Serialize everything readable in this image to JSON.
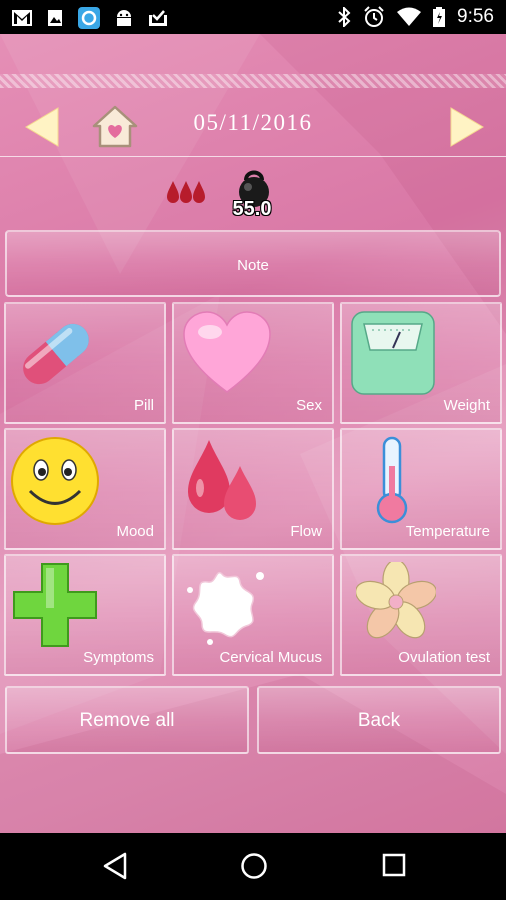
{
  "status_bar": {
    "time": "9:56",
    "left_icons": [
      "gmail-icon",
      "photo-icon",
      "sync-app-icon",
      "android-icon",
      "download-done-icon"
    ],
    "right_icons": [
      "bluetooth-icon",
      "alarm-icon",
      "wifi-icon",
      "battery-icon"
    ]
  },
  "header": {
    "date": "05/11/2016",
    "prev_icon": "left-arrow-icon",
    "next_icon": "right-arrow-icon",
    "home_icon": "home-heart-icon"
  },
  "summary": {
    "flow_icon": "three-blood-drops-icon",
    "weight_icon": "kettlebell-icon",
    "weight_value": "55.0"
  },
  "note_label": "Note",
  "tiles": [
    {
      "label": "Pill",
      "icon": "pill-icon"
    },
    {
      "label": "Sex",
      "icon": "heart-icon"
    },
    {
      "label": "Weight",
      "icon": "scale-icon"
    },
    {
      "label": "Mood",
      "icon": "smiley-icon"
    },
    {
      "label": "Flow",
      "icon": "drops-icon"
    },
    {
      "label": "Temperature",
      "icon": "thermometer-icon"
    },
    {
      "label": "Symptoms",
      "icon": "plus-cross-icon"
    },
    {
      "label": "Cervical Mucus",
      "icon": "splash-icon"
    },
    {
      "label": "Ovulation test",
      "icon": "flower-icon"
    }
  ],
  "bottom_buttons": {
    "remove_all": "Remove all",
    "back": "Back"
  },
  "colors": {
    "background": "#df86ae",
    "arrow": "#fff3c4",
    "pill_pink": "#e0507a",
    "pill_blue": "#7fc0ea",
    "heart": "#ffa6d8",
    "green_cross": "#6fd63e",
    "smiley": "#ffe030"
  }
}
